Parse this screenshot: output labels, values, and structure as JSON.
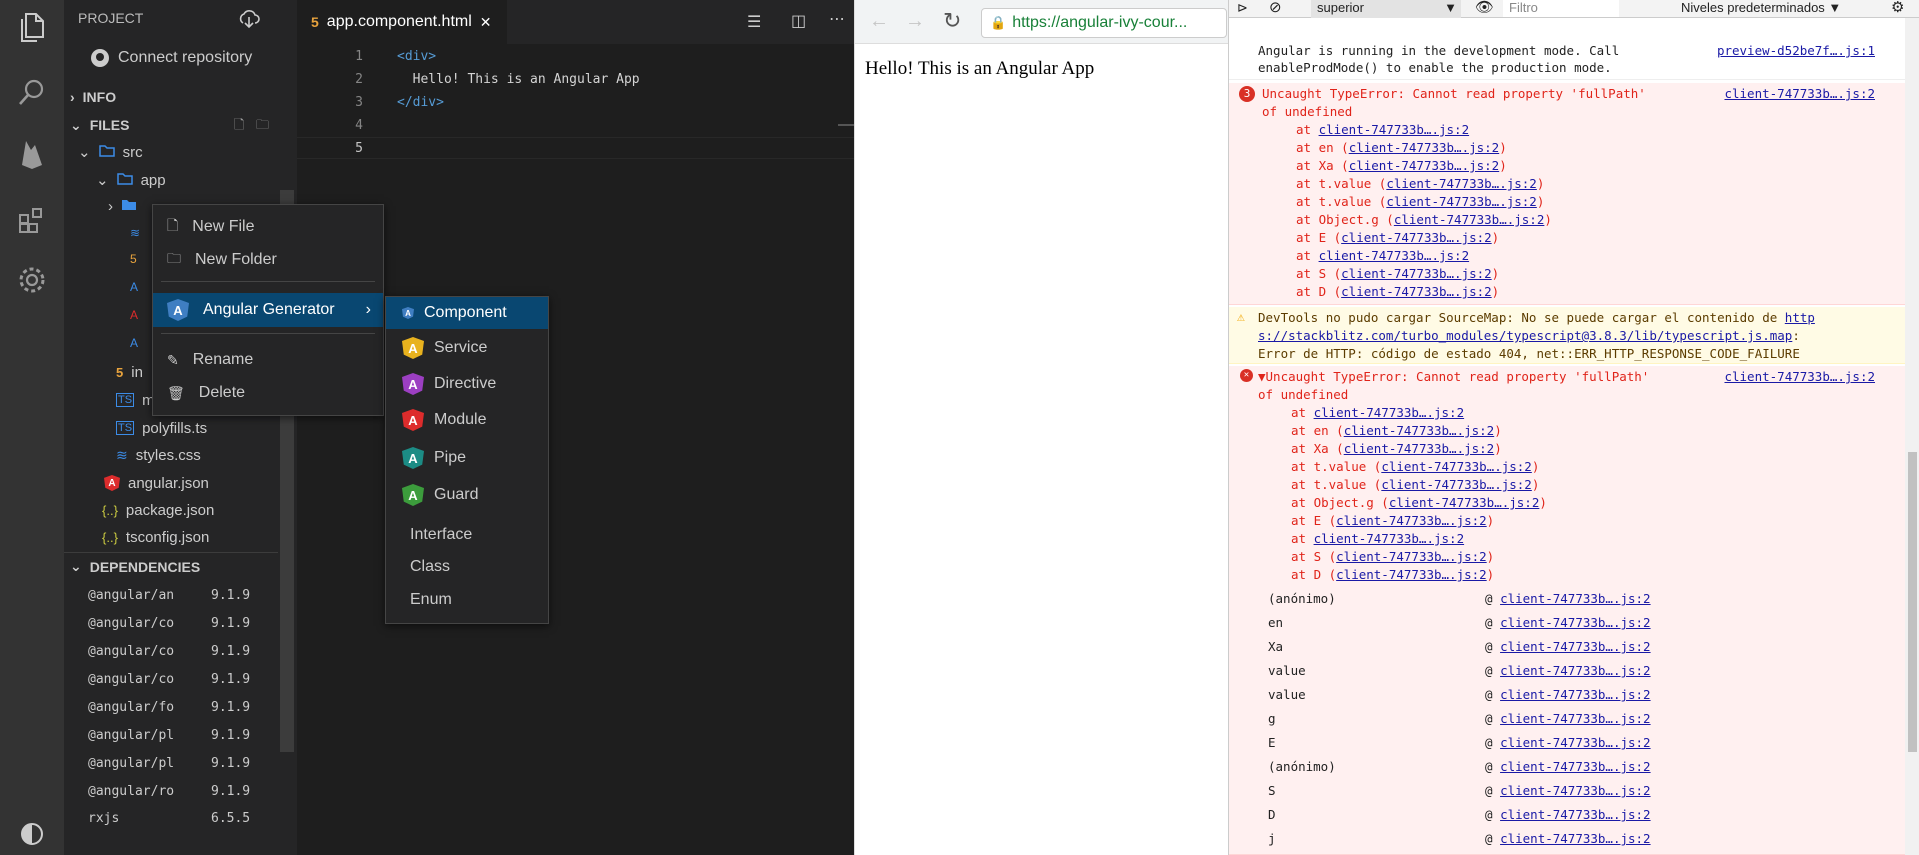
{
  "sidebar": {
    "header": "PROJECT",
    "connect": "Connect repository",
    "info": "INFO",
    "files": "FILES",
    "dependencies": "DEPENDENCIES",
    "tree": [
      {
        "label": "src",
        "depth": 1,
        "kind": "folder"
      },
      {
        "label": "app",
        "depth": 2,
        "kind": "folder"
      },
      {
        "label": "",
        "depth": 3,
        "kind": "folder"
      },
      {
        "label": "in",
        "depth": 3,
        "kind": "html"
      },
      {
        "label": "m",
        "depth": 3,
        "kind": "ts"
      },
      {
        "label": "polyfills.ts",
        "depth": 3,
        "kind": "ts"
      },
      {
        "label": "styles.css",
        "depth": 3,
        "kind": "css"
      },
      {
        "label": "angular.json",
        "depth": 2,
        "kind": "angular"
      },
      {
        "label": "package.json",
        "depth": 2,
        "kind": "json"
      },
      {
        "label": "tsconfig.json",
        "depth": 2,
        "kind": "json"
      }
    ],
    "deps": [
      {
        "name": "@angular/an",
        "version": "9.1.9"
      },
      {
        "name": "@angular/co",
        "version": "9.1.9"
      },
      {
        "name": "@angular/co",
        "version": "9.1.9"
      },
      {
        "name": "@angular/co",
        "version": "9.1.9"
      },
      {
        "name": "@angular/fo",
        "version": "9.1.9"
      },
      {
        "name": "@angular/pl",
        "version": "9.1.9"
      },
      {
        "name": "@angular/pl",
        "version": "9.1.9"
      },
      {
        "name": "@angular/ro",
        "version": "9.1.9"
      },
      {
        "name": "rxjs",
        "version": "6.5.5"
      }
    ]
  },
  "editor": {
    "tab": "app.component.html",
    "lines": [
      "<div>",
      "  Hello! This is an Angular App",
      "</div>",
      "",
      ""
    ]
  },
  "browser": {
    "url": "https://angular-ivy-cour...",
    "page_text": "Hello! This is an Angular App"
  },
  "devtools": {
    "context": "superior",
    "filter_placeholder": "Filtro",
    "levels": "Niveles predeterminados ▼",
    "dev_mode_line1": "Angular is running in the development mode. Call",
    "dev_mode_line2": "enableProdMode() to enable the production mode.",
    "dev_mode_src": "preview-d52be7f….js:1",
    "err1_count": "3",
    "err1_line1": "Uncaught TypeError: Cannot read property 'fullPath'",
    "err1_line2": "of undefined",
    "err1_src": "client-747733b….js:2",
    "stack": [
      {
        "fn": "at ",
        "link": "client-747733b….js:2",
        "paren": false
      },
      {
        "fn": "at en (",
        "link": "client-747733b….js:2",
        "paren": true
      },
      {
        "fn": "at Xa (",
        "link": "client-747733b….js:2",
        "paren": true
      },
      {
        "fn": "at t.value (",
        "link": "client-747733b….js:2",
        "paren": true
      },
      {
        "fn": "at t.value (",
        "link": "client-747733b….js:2",
        "paren": true
      },
      {
        "fn": "at Object.g (",
        "link": "client-747733b….js:2",
        "paren": true
      },
      {
        "fn": "at E (",
        "link": "client-747733b….js:2",
        "paren": true
      },
      {
        "fn": "at ",
        "link": "client-747733b….js:2",
        "paren": false
      },
      {
        "fn": "at S (",
        "link": "client-747733b….js:2",
        "paren": true
      },
      {
        "fn": "at D (",
        "link": "client-747733b….js:2",
        "paren": true
      }
    ],
    "warn_line1a": "DevTools no pudo cargar SourceMap: No se puede cargar el contenido de ",
    "warn_link1": "http",
    "warn_link2": "s://stackblitz.com/turbo_modules/typescript@3.8.3/lib/typescript.js.map",
    "warn_line3": "Error de HTTP: código de estado 404, net::ERR_HTTP_RESPONSE_CODE_FAILURE",
    "err2_line1": "▼Uncaught TypeError: Cannot read property 'fullPath'",
    "err2_line2": "of undefined",
    "err2_src": "client-747733b….js:2",
    "frames": [
      {
        "fn": "(anónimo)",
        "link": "client-747733b….js:2"
      },
      {
        "fn": "en",
        "link": "client-747733b….js:2"
      },
      {
        "fn": "Xa",
        "link": "client-747733b….js:2"
      },
      {
        "fn": "value",
        "link": "client-747733b….js:2"
      },
      {
        "fn": "value",
        "link": "client-747733b….js:2"
      },
      {
        "fn": "g",
        "link": "client-747733b….js:2"
      },
      {
        "fn": "E",
        "link": "client-747733b….js:2"
      },
      {
        "fn": "(anónimo)",
        "link": "client-747733b….js:2"
      },
      {
        "fn": "S",
        "link": "client-747733b….js:2"
      },
      {
        "fn": "D",
        "link": "client-747733b….js:2"
      },
      {
        "fn": "j",
        "link": "client-747733b….js:2"
      }
    ]
  },
  "context_menu": {
    "items": [
      "New File",
      "New Folder",
      "Angular Generator",
      "Rename",
      "Delete"
    ],
    "submenu": [
      {
        "label": "Component",
        "color": "#3f7ec2"
      },
      {
        "label": "Service",
        "color": "#e8b21e"
      },
      {
        "label": "Directive",
        "color": "#9c3fc2"
      },
      {
        "label": "Module",
        "color": "#dd2c2c"
      },
      {
        "label": "Pipe",
        "color": "#1c8c85"
      },
      {
        "label": "Guard",
        "color": "#3c9c3c"
      },
      {
        "label": "Interface",
        "color": ""
      },
      {
        "label": "Class",
        "color": ""
      },
      {
        "label": "Enum",
        "color": ""
      }
    ]
  }
}
